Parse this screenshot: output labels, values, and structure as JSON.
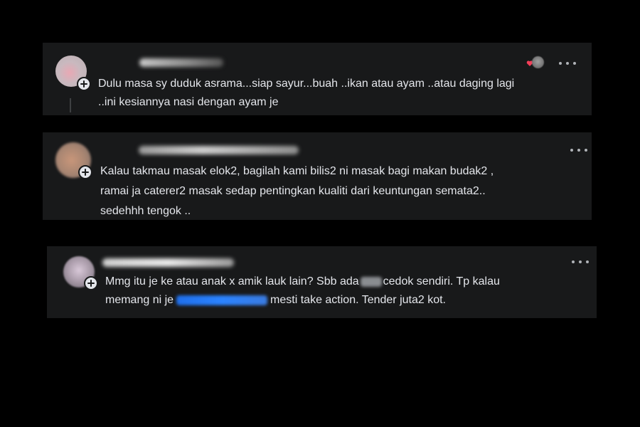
{
  "comments": [
    {
      "text_lines": [
        "Dulu masa sy duduk asrama...siap sayur...buah ..ikan atau ayam ..atau daging lagi",
        "..ini kesiannya nasi dengan ayam je"
      ]
    },
    {
      "text_lines": [
        "Kalau takmau masak elok2, bagilah kami bilis2 ni masak bagi makan budak2 ,",
        "ramai ja caterer2 masak sedap pentingkan kualiti dari keuntungan semata2..",
        "sedehhh tengok .."
      ]
    },
    {
      "line1_before": "Mmg itu je ke atau anak x amik lauk lain? Sbb ada",
      "line1_after": "cedok sendiri. Tp kalau",
      "line2_before": "memang ni je",
      "line2_after": "mesti take action. Tender juta2 kot."
    }
  ],
  "icons": {
    "more": "more-options-icon",
    "add": "add-friend-badge-icon",
    "reaction": "heart-reaction-icon"
  },
  "colors": {
    "background": "#000000",
    "card": "#18191a",
    "text": "#e4e6eb",
    "secondary": "#b0b3b8",
    "heart": "#f33e58",
    "link": "#2b83ff"
  }
}
